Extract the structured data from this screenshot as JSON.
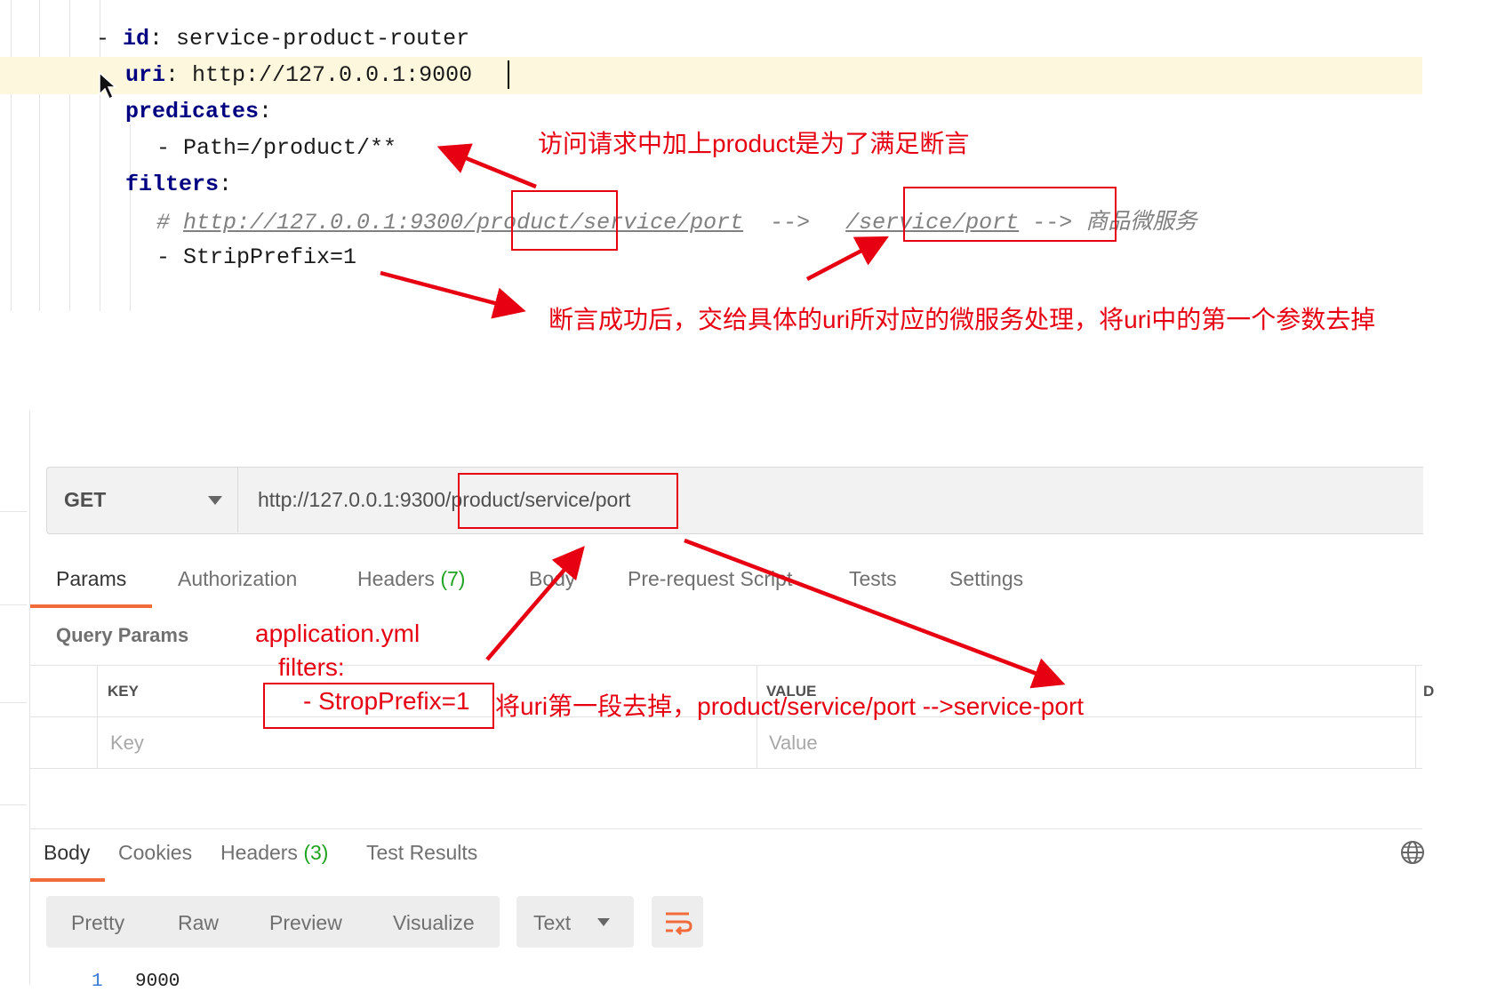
{
  "editor": {
    "line1_dash": "- ",
    "line1_key": "id",
    "line1_val": " service-product-router",
    "line2_key": "uri",
    "line2_val": " http://127.0.0.1:9000",
    "line3_key": "predicates",
    "line4": "- Path=/product/**",
    "line5_key": "filters",
    "comment_hash": "# ",
    "comment_url": "http://127.0.0.1:9300/product/service/port",
    "comment_arrow1": "  -->  ",
    "comment_target": "/service/port",
    "comment_arrow2": " --> ",
    "comment_service": "商品微服务",
    "line7": "- StripPrefix=1"
  },
  "annotations": {
    "note_predicate": "访问请求中加上product是为了满足断言",
    "note_stripprefix": "断言成功后，交给具体的uri所对应的微服务处理，将uri中的第一个参数去掉",
    "note_app_yml": "application.yml",
    "note_filters": "filters:",
    "note_strop": "- StropPrefix=1",
    "note_strop_desc": "将uri第一段去掉，product/service/port  -->service-port"
  },
  "request": {
    "method": "GET",
    "url": "http://127.0.0.1:9300/product/service/port"
  },
  "tabs": {
    "params": "Params",
    "authorization": "Authorization",
    "headers": "Headers",
    "headers_count": "(7)",
    "body": "Body",
    "prerequest": "Pre-request Script",
    "tests": "Tests",
    "settings": "Settings"
  },
  "query_params": {
    "label": "Query Params",
    "col_key": "KEY",
    "col_value": "VALUE",
    "col_desc": "D",
    "key_placeholder": "Key",
    "value_placeholder": "Value"
  },
  "response": {
    "tabs": {
      "body": "Body",
      "cookies": "Cookies",
      "headers": "Headers",
      "headers_count": "(3)",
      "test_results": "Test Results"
    },
    "formats": [
      "Pretty",
      "Raw",
      "Preview",
      "Visualize"
    ],
    "text_mode": "Text",
    "line_number": "1",
    "line_value": "9000"
  },
  "colors": {
    "annotation_red": "#e60012",
    "active_tab_underline": "#f26b3a",
    "count_green": "#21a321",
    "keyword_navy": "#000080"
  },
  "icons": [
    "mouse-pointer-icon",
    "chevron-down-icon",
    "wrap-lines-icon",
    "globe-icon"
  ]
}
